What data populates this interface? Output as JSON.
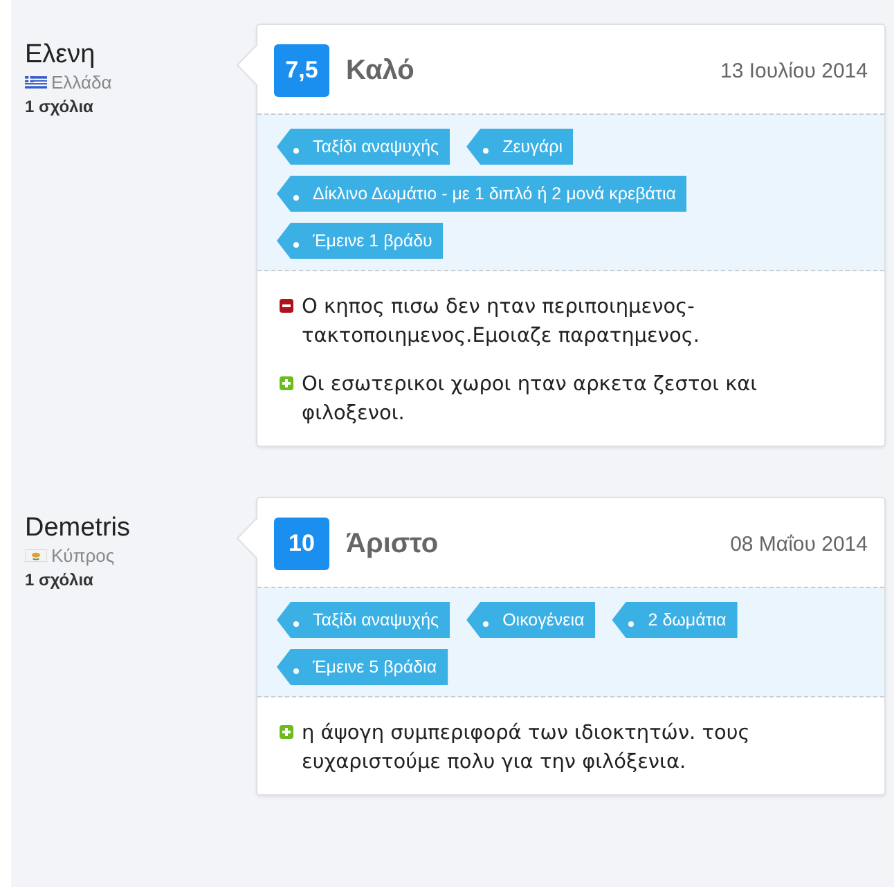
{
  "reviews": [
    {
      "author": "Ελενη",
      "kind": "greece",
      "country": "Ελλάδα",
      "comment_count": "1 σχόλια",
      "score": "7,5",
      "rating_label": "Καλό",
      "date": "13 Ιουλίου 2014",
      "tags": [
        "Ταξίδι αναψυχής",
        "Ζευγάρι",
        "Δίκλινο Δωμάτιο - με 1 διπλό ή 2 μονά κρεβάτια",
        "Έμεινε 1 βράδυ"
      ],
      "comments": [
        {
          "kind": "negative",
          "text": "Ο κηπος πισω δεν ηταν περιποιημενος-τακτοποιημενος.Εμοιαζε παρατημενος."
        },
        {
          "kind": "positive",
          "text": "Οι εσωτερικοι χωροι ηταν αρκετα ζεστοι και φιλοξενοι."
        }
      ]
    },
    {
      "author": "Demetris",
      "kind": "cyprus",
      "country": "Κύπρος",
      "comment_count": "1 σχόλια",
      "score": "10",
      "rating_label": "Άριστο",
      "date": "08 Μαΐου 2014",
      "tags": [
        "Ταξίδι αναψυχής",
        "Οικογένεια",
        "2 δωμάτια",
        "Έμεινε 5 βράδια"
      ],
      "comments": [
        {
          "kind": "positive",
          "text": "η άψογη συμπεριφορά των ιδιοκτητών. τους ευχαριστούμε πολυ για την φιλόξενια."
        }
      ]
    }
  ]
}
